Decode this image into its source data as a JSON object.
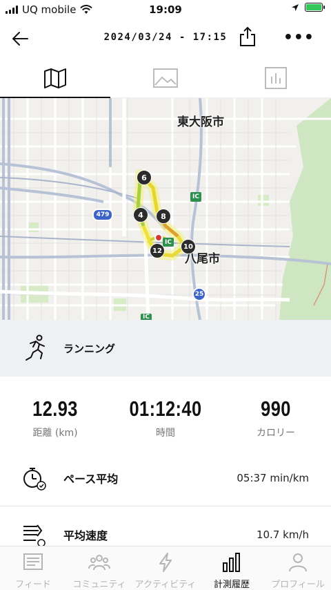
{
  "status": {
    "carrier": "UQ mobile",
    "time": "19:09"
  },
  "header": {
    "title": "2024/03/24 - 17:15"
  },
  "tabs": [
    {
      "icon": "map-icon"
    },
    {
      "icon": "image-icon"
    },
    {
      "icon": "chart-icon"
    }
  ],
  "map": {
    "labels": {
      "city1": "東大阪市",
      "city2": "八尾市"
    },
    "shields": {
      "route479": "479",
      "route25": "25",
      "ic1": "IC",
      "ic2": "IC",
      "ic3": "IC"
    },
    "km_markers": [
      "6",
      "4",
      "8",
      "12",
      "10"
    ]
  },
  "activity": {
    "type": "ランニング"
  },
  "stats": [
    {
      "value": "12.93",
      "label": "距離 (km)"
    },
    {
      "value": "01:12:40",
      "label": "時間"
    },
    {
      "value": "990",
      "label": "カロリー"
    }
  ],
  "details": [
    {
      "name": "ペース平均",
      "value": "05:37 min/km"
    },
    {
      "name": "平均速度",
      "value": "10.7 km/h"
    }
  ],
  "nav": [
    {
      "label": "フィード"
    },
    {
      "label": "コミュニティ"
    },
    {
      "label": "アクティビティ"
    },
    {
      "label": "計測履歴"
    },
    {
      "label": "プロフィール"
    }
  ]
}
